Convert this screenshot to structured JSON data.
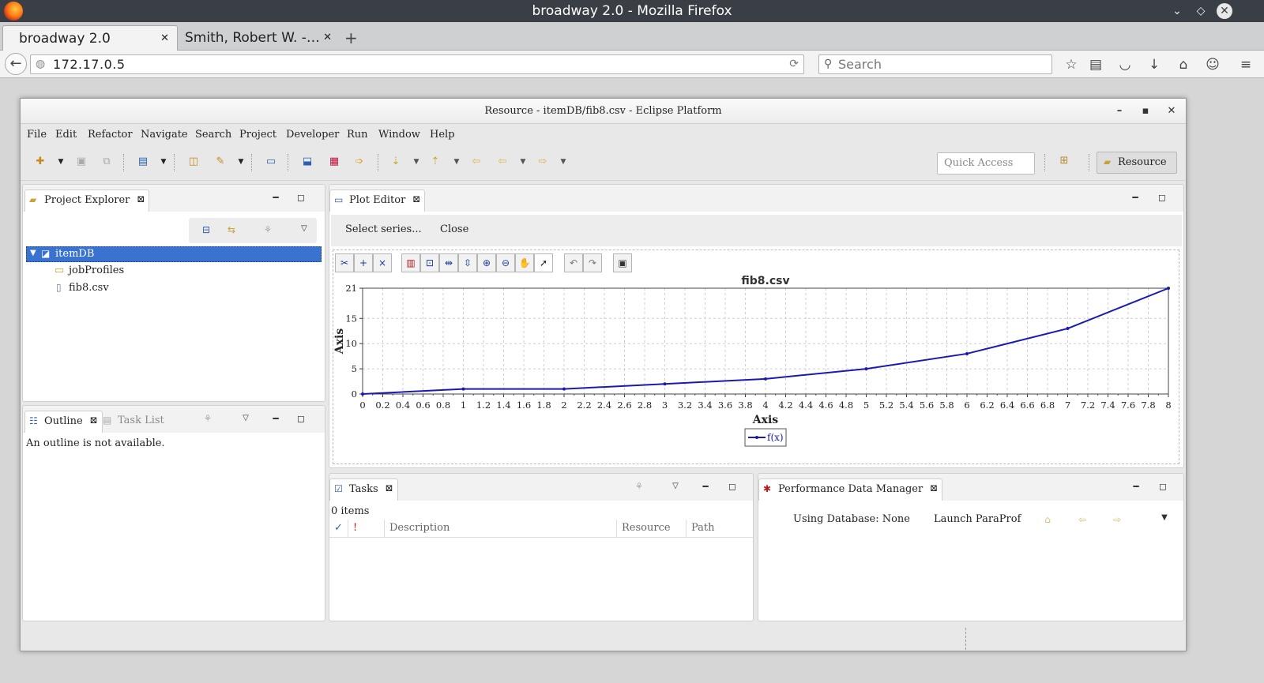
{
  "browser": {
    "window_title": "broadway 2.0 - Mozilla Firefox",
    "tabs": [
      {
        "label": "broadway 2.0",
        "active": true
      },
      {
        "label": "Smith, Robert W. -…",
        "active": false
      }
    ],
    "url": "172.17.0.5",
    "search_placeholder": "Search"
  },
  "eclipse": {
    "window_title": "Resource - itemDB/fib8.csv - Eclipse Platform",
    "menu": [
      "File",
      "Edit",
      "Refactor",
      "Navigate",
      "Search",
      "Project",
      "Developer",
      "Run",
      "Window",
      "Help"
    ],
    "quick_access_placeholder": "Quick Access",
    "perspective": "Resource",
    "project_explorer": {
      "tab": "Project Explorer",
      "tree": [
        {
          "label": "itemDB",
          "level": 0,
          "icon": "open-project-icon",
          "selected": true
        },
        {
          "label": "jobProfiles",
          "level": 1,
          "icon": "folder-icon",
          "selected": false
        },
        {
          "label": "fib8.csv",
          "level": 1,
          "icon": "file-icon",
          "selected": false
        }
      ]
    },
    "outline": {
      "tab": "Outline",
      "other_tab": "Task List",
      "message": "An outline is not available."
    },
    "plot_editor": {
      "tab": "Plot Editor",
      "actions": [
        "Select series...",
        "Close"
      ]
    },
    "tasks": {
      "tab": "Tasks",
      "count": "0 items",
      "columns": [
        "✓",
        "!",
        "Description",
        "Resource",
        "Path"
      ]
    },
    "perf": {
      "tab": "Performance Data Manager",
      "database": "Using Database: None",
      "launch": "Launch ParaProf"
    }
  },
  "chart_data": {
    "type": "line",
    "title": "fib8.csv",
    "xlabel": "Axis",
    "ylabel": "Axis",
    "xlim": [
      0,
      8
    ],
    "ylim": [
      0,
      21
    ],
    "x_ticks": [
      "0",
      "0.2",
      "0.4",
      "0.6",
      "0.8",
      "1",
      "1.2",
      "1.4",
      "1.6",
      "1.8",
      "2",
      "2.2",
      "2.4",
      "2.6",
      "2.8",
      "3",
      "3.2",
      "3.4",
      "3.6",
      "3.8",
      "4",
      "4.2",
      "4.4",
      "4.6",
      "4.8",
      "5",
      "5.2",
      "5.4",
      "5.6",
      "5.8",
      "6",
      "6.2",
      "6.4",
      "6.6",
      "6.8",
      "7",
      "7.2",
      "7.4",
      "7.6",
      "7.8",
      "8"
    ],
    "y_ticks": [
      "0",
      "5",
      "10",
      "15",
      "21"
    ],
    "grid": true,
    "legend": "bottom-center",
    "series": [
      {
        "name": "f(x)",
        "color": "#1a1ab0",
        "x": [
          0,
          1,
          2,
          3,
          4,
          5,
          6,
          7,
          8
        ],
        "y": [
          0,
          1,
          1,
          2,
          3,
          5,
          8,
          13,
          21
        ]
      }
    ]
  }
}
